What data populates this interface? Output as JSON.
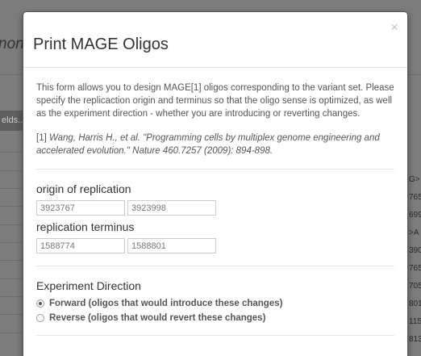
{
  "background": {
    "title_fragment": "non",
    "filter_fragment": "elds...",
    "right_fragments": [
      "G>",
      "765",
      "699",
      ">A",
      "390",
      "765",
      "705",
      "801",
      "115",
      "813"
    ]
  },
  "modal": {
    "title": "Print MAGE Oligos",
    "close_label": "×",
    "description": "This form allows you to design MAGE[1] oligos corresponding to the variant set. Please specify the replicaction origin and terminus so that the oligo sense is optimized, as well as the experiment direction - whether you are introducing or reverting changes.",
    "citation_prefix": "[1] ",
    "citation_text": "Wang, Harris H., et al. \"Programming cells by multiplex genome engineering and accelerated evolution.\" Nature 460.7257 (2009): 894-898.",
    "origin": {
      "label": "origin of replication",
      "start": "3923767",
      "end": "3923998"
    },
    "terminus": {
      "label": "replication terminus",
      "start": "1588774",
      "end": "1588801"
    },
    "experiment": {
      "label": "Experiment Direction",
      "options": [
        {
          "label": "Forward (oligos that would introduce these changes)",
          "checked": true
        },
        {
          "label": "Reverse (oligos that would revert these changes)",
          "checked": false
        }
      ]
    }
  }
}
